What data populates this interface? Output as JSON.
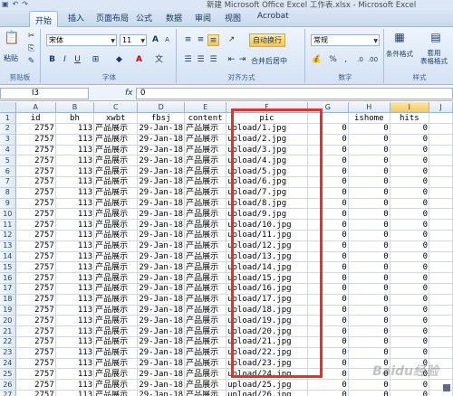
{
  "window": {
    "title": "新建 Microsoft Office Excel 工作表.xlsx - Microsoft Excel"
  },
  "ribbon": {
    "tabs": [
      "开始",
      "插入",
      "页面布局",
      "公式",
      "数据",
      "审阅",
      "视图",
      "Acrobat"
    ],
    "active_tab": "开始",
    "clipboard": {
      "paste": "粘贴",
      "label": "剪贴板"
    },
    "font": {
      "name": "宋体",
      "size": "11",
      "label": "字体",
      "bold": "B",
      "italic": "I",
      "underline": "U",
      "grow": "A",
      "shrink": "A",
      "font_color": "A"
    },
    "alignment": {
      "wrap": "自动换行",
      "merge": "合并后居中",
      "label": "对齐方式"
    },
    "number": {
      "format": "常规",
      "percent": "%",
      "comma": ",",
      "label": "数字"
    },
    "styles": {
      "conditional": "条件格式",
      "table": "套用\n表格格式",
      "label": "样式"
    }
  },
  "formula_bar": {
    "name_box": "I3",
    "fx": "fx",
    "value": "0"
  },
  "columns": [
    "A",
    "B",
    "C",
    "D",
    "E",
    "F",
    "G",
    "H",
    "I",
    "J"
  ],
  "selected_column": "I",
  "header_row": {
    "row": "1",
    "cells": [
      "id",
      "bh",
      "xwbt",
      "fbsj",
      "content",
      "pic",
      "",
      "ishome",
      "hits",
      ""
    ]
  },
  "rows": [
    {
      "row": "2",
      "id": "2757",
      "bh": "113",
      "xwbt": "产品展示",
      "fbsj": "29-Jan-18",
      "content": "产品展示",
      "pic": "upload/1.jpg",
      "g": "0",
      "ishome": "0",
      "hits": "0"
    },
    {
      "row": "3",
      "id": "2757",
      "bh": "113",
      "xwbt": "产品展示",
      "fbsj": "29-Jan-18",
      "content": "产品展示",
      "pic": "upload/2.jpg",
      "g": "0",
      "ishome": "0",
      "hits": "0"
    },
    {
      "row": "4",
      "id": "2757",
      "bh": "113",
      "xwbt": "产品展示",
      "fbsj": "29-Jan-18",
      "content": "产品展示",
      "pic": "upload/3.jpg",
      "g": "0",
      "ishome": "0",
      "hits": "0"
    },
    {
      "row": "5",
      "id": "2757",
      "bh": "113",
      "xwbt": "产品展示",
      "fbsj": "29-Jan-18",
      "content": "产品展示",
      "pic": "upload/4.jpg",
      "g": "0",
      "ishome": "0",
      "hits": "0"
    },
    {
      "row": "6",
      "id": "2757",
      "bh": "113",
      "xwbt": "产品展示",
      "fbsj": "29-Jan-18",
      "content": "产品展示",
      "pic": "upload/5.jpg",
      "g": "0",
      "ishome": "0",
      "hits": "0"
    },
    {
      "row": "7",
      "id": "2757",
      "bh": "113",
      "xwbt": "产品展示",
      "fbsj": "29-Jan-18",
      "content": "产品展示",
      "pic": "upload/6.jpg",
      "g": "0",
      "ishome": "0",
      "hits": "0"
    },
    {
      "row": "8",
      "id": "2757",
      "bh": "113",
      "xwbt": "产品展示",
      "fbsj": "29-Jan-18",
      "content": "产品展示",
      "pic": "upload/7.jpg",
      "g": "0",
      "ishome": "0",
      "hits": "0"
    },
    {
      "row": "9",
      "id": "2757",
      "bh": "113",
      "xwbt": "产品展示",
      "fbsj": "29-Jan-18",
      "content": "产品展示",
      "pic": "upload/8.jpg",
      "g": "0",
      "ishome": "0",
      "hits": "0"
    },
    {
      "row": "10",
      "id": "2757",
      "bh": "113",
      "xwbt": "产品展示",
      "fbsj": "29-Jan-18",
      "content": "产品展示",
      "pic": "upload/9.jpg",
      "g": "0",
      "ishome": "0",
      "hits": "0"
    },
    {
      "row": "11",
      "id": "2757",
      "bh": "113",
      "xwbt": "产品展示",
      "fbsj": "29-Jan-18",
      "content": "产品展示",
      "pic": "upload/10.jpg",
      "g": "0",
      "ishome": "0",
      "hits": "0"
    },
    {
      "row": "12",
      "id": "2757",
      "bh": "113",
      "xwbt": "产品展示",
      "fbsj": "29-Jan-18",
      "content": "产品展示",
      "pic": "upload/11.jpg",
      "g": "0",
      "ishome": "0",
      "hits": "0"
    },
    {
      "row": "13",
      "id": "2757",
      "bh": "113",
      "xwbt": "产品展示",
      "fbsj": "29-Jan-18",
      "content": "产品展示",
      "pic": "upload/12.jpg",
      "g": "0",
      "ishome": "0",
      "hits": "0"
    },
    {
      "row": "14",
      "id": "2757",
      "bh": "113",
      "xwbt": "产品展示",
      "fbsj": "29-Jan-18",
      "content": "产品展示",
      "pic": "upload/13.jpg",
      "g": "0",
      "ishome": "0",
      "hits": "0"
    },
    {
      "row": "15",
      "id": "2757",
      "bh": "113",
      "xwbt": "产品展示",
      "fbsj": "29-Jan-18",
      "content": "产品展示",
      "pic": "upload/14.jpg",
      "g": "0",
      "ishome": "0",
      "hits": "0"
    },
    {
      "row": "16",
      "id": "2757",
      "bh": "113",
      "xwbt": "产品展示",
      "fbsj": "29-Jan-18",
      "content": "产品展示",
      "pic": "upload/15.jpg",
      "g": "0",
      "ishome": "0",
      "hits": "0"
    },
    {
      "row": "17",
      "id": "2757",
      "bh": "113",
      "xwbt": "产品展示",
      "fbsj": "29-Jan-18",
      "content": "产品展示",
      "pic": "upload/16.jpg",
      "g": "0",
      "ishome": "0",
      "hits": "0"
    },
    {
      "row": "18",
      "id": "2757",
      "bh": "113",
      "xwbt": "产品展示",
      "fbsj": "29-Jan-18",
      "content": "产品展示",
      "pic": "upload/17.jpg",
      "g": "0",
      "ishome": "0",
      "hits": "0"
    },
    {
      "row": "19",
      "id": "2757",
      "bh": "113",
      "xwbt": "产品展示",
      "fbsj": "29-Jan-18",
      "content": "产品展示",
      "pic": "upload/18.jpg",
      "g": "0",
      "ishome": "0",
      "hits": "0"
    },
    {
      "row": "20",
      "id": "2757",
      "bh": "113",
      "xwbt": "产品展示",
      "fbsj": "29-Jan-18",
      "content": "产品展示",
      "pic": "upload/19.jpg",
      "g": "0",
      "ishome": "0",
      "hits": "0"
    },
    {
      "row": "21",
      "id": "2757",
      "bh": "113",
      "xwbt": "产品展示",
      "fbsj": "29-Jan-18",
      "content": "产品展示",
      "pic": "upload/20.jpg",
      "g": "0",
      "ishome": "0",
      "hits": "0"
    },
    {
      "row": "22",
      "id": "2757",
      "bh": "113",
      "xwbt": "产品展示",
      "fbsj": "29-Jan-18",
      "content": "产品展示",
      "pic": "upload/21.jpg",
      "g": "0",
      "ishome": "0",
      "hits": "0"
    },
    {
      "row": "23",
      "id": "2757",
      "bh": "113",
      "xwbt": "产品展示",
      "fbsj": "29-Jan-18",
      "content": "产品展示",
      "pic": "upload/22.jpg",
      "g": "0",
      "ishome": "0",
      "hits": "0"
    },
    {
      "row": "24",
      "id": "2757",
      "bh": "113",
      "xwbt": "产品展示",
      "fbsj": "29-Jan-18",
      "content": "产品展示",
      "pic": "upload/23.jpg",
      "g": "0",
      "ishome": "0",
      "hits": "0"
    },
    {
      "row": "25",
      "id": "2757",
      "bh": "113",
      "xwbt": "产品展示",
      "fbsj": "29-Jan-18",
      "content": "产品展示",
      "pic": "upload/24.jpg",
      "g": "0",
      "ishome": "0",
      "hits": "0"
    },
    {
      "row": "26",
      "id": "2757",
      "bh": "113",
      "xwbt": "产品展示",
      "fbsj": "29-Jan-18",
      "content": "产品展示",
      "pic": "upload/25.jpg",
      "g": "0",
      "ishome": "0",
      "hits": "0"
    },
    {
      "row": "27",
      "id": "2757",
      "bh": "113",
      "xwbt": "产品展示",
      "fbsj": "29-Jan-18",
      "content": "产品展示",
      "pic": "upload/26.jpg",
      "g": "0",
      "ishome": "0",
      "hits": "0"
    }
  ],
  "watermark": "Baidu经验",
  "colors": {
    "highlight_border": "#e8302a",
    "selected_header": "#f5c95c"
  }
}
